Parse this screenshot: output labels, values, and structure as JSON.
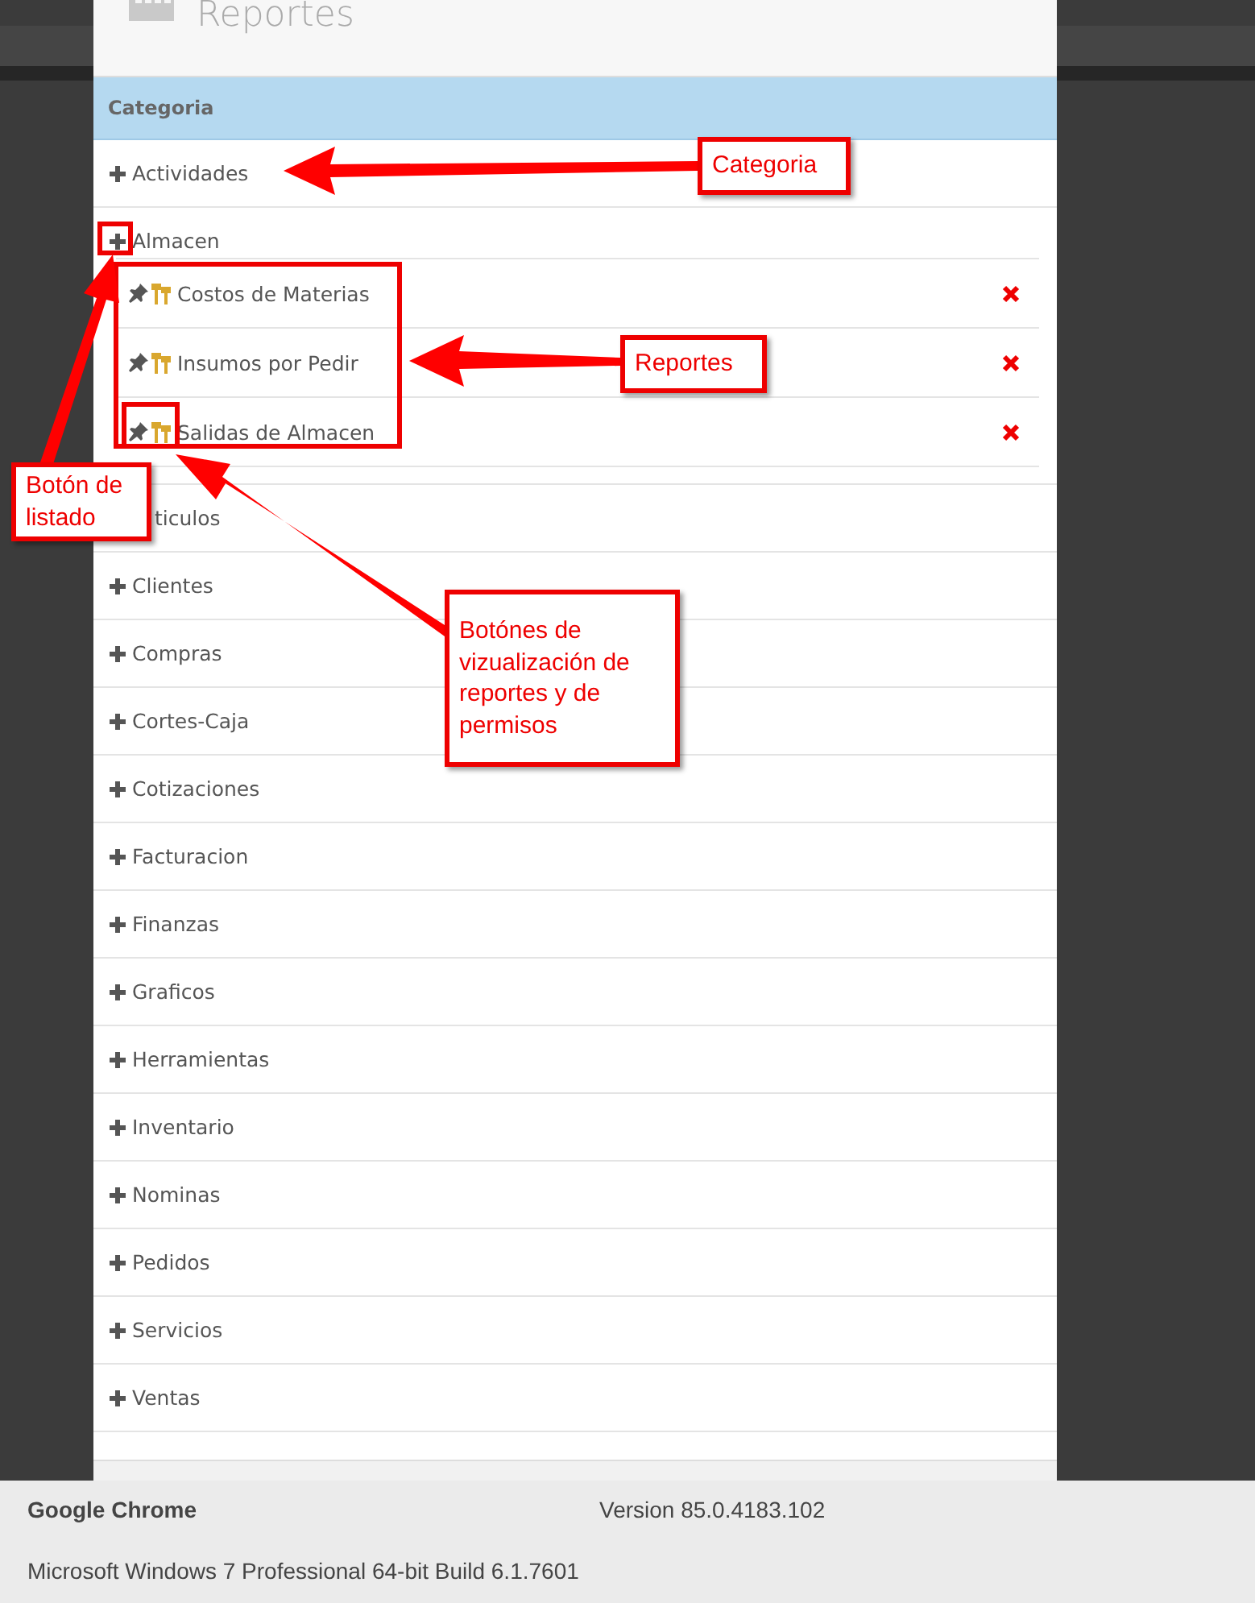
{
  "modal": {
    "title": "Reportes"
  },
  "table": {
    "header": "Categoria",
    "categories": [
      {
        "name": "Actividades",
        "plus_covered": false
      },
      {
        "name": "Almacen",
        "plus_covered": false,
        "children": [
          {
            "name": "Costos de Materias"
          },
          {
            "name": "Insumos por Pedir"
          },
          {
            "name": "Salidas de Almacen"
          }
        ]
      },
      {
        "name": "ticulos",
        "plus_covered": true
      },
      {
        "name": "Clientes",
        "plus_covered": false
      },
      {
        "name": "Compras",
        "plus_covered": false
      },
      {
        "name": "Cortes-Caja",
        "plus_covered": false
      },
      {
        "name": "Cotizaciones",
        "plus_covered": false
      },
      {
        "name": "Facturacion",
        "plus_covered": false
      },
      {
        "name": "Finanzas",
        "plus_covered": false
      },
      {
        "name": "Graficos",
        "plus_covered": false
      },
      {
        "name": "Herramientas",
        "plus_covered": false
      },
      {
        "name": "Inventario",
        "plus_covered": false
      },
      {
        "name": "Nominas",
        "plus_covered": false
      },
      {
        "name": "Pedidos",
        "plus_covered": false
      },
      {
        "name": "Servicios",
        "plus_covered": false
      },
      {
        "name": "Ventas",
        "plus_covered": false
      }
    ]
  },
  "annotations": [
    {
      "text": "Categoria"
    },
    {
      "text": "Reportes"
    },
    {
      "text": "Botón de listado"
    },
    {
      "text": "Botónes de vizualización de reportes y de permisos"
    }
  ],
  "about_panel": {
    "product": "Google Chrome",
    "version": "Version 85.0.4183.102",
    "os": "Microsoft Windows 7 Professional  64-bit Build 6.1.7601"
  }
}
